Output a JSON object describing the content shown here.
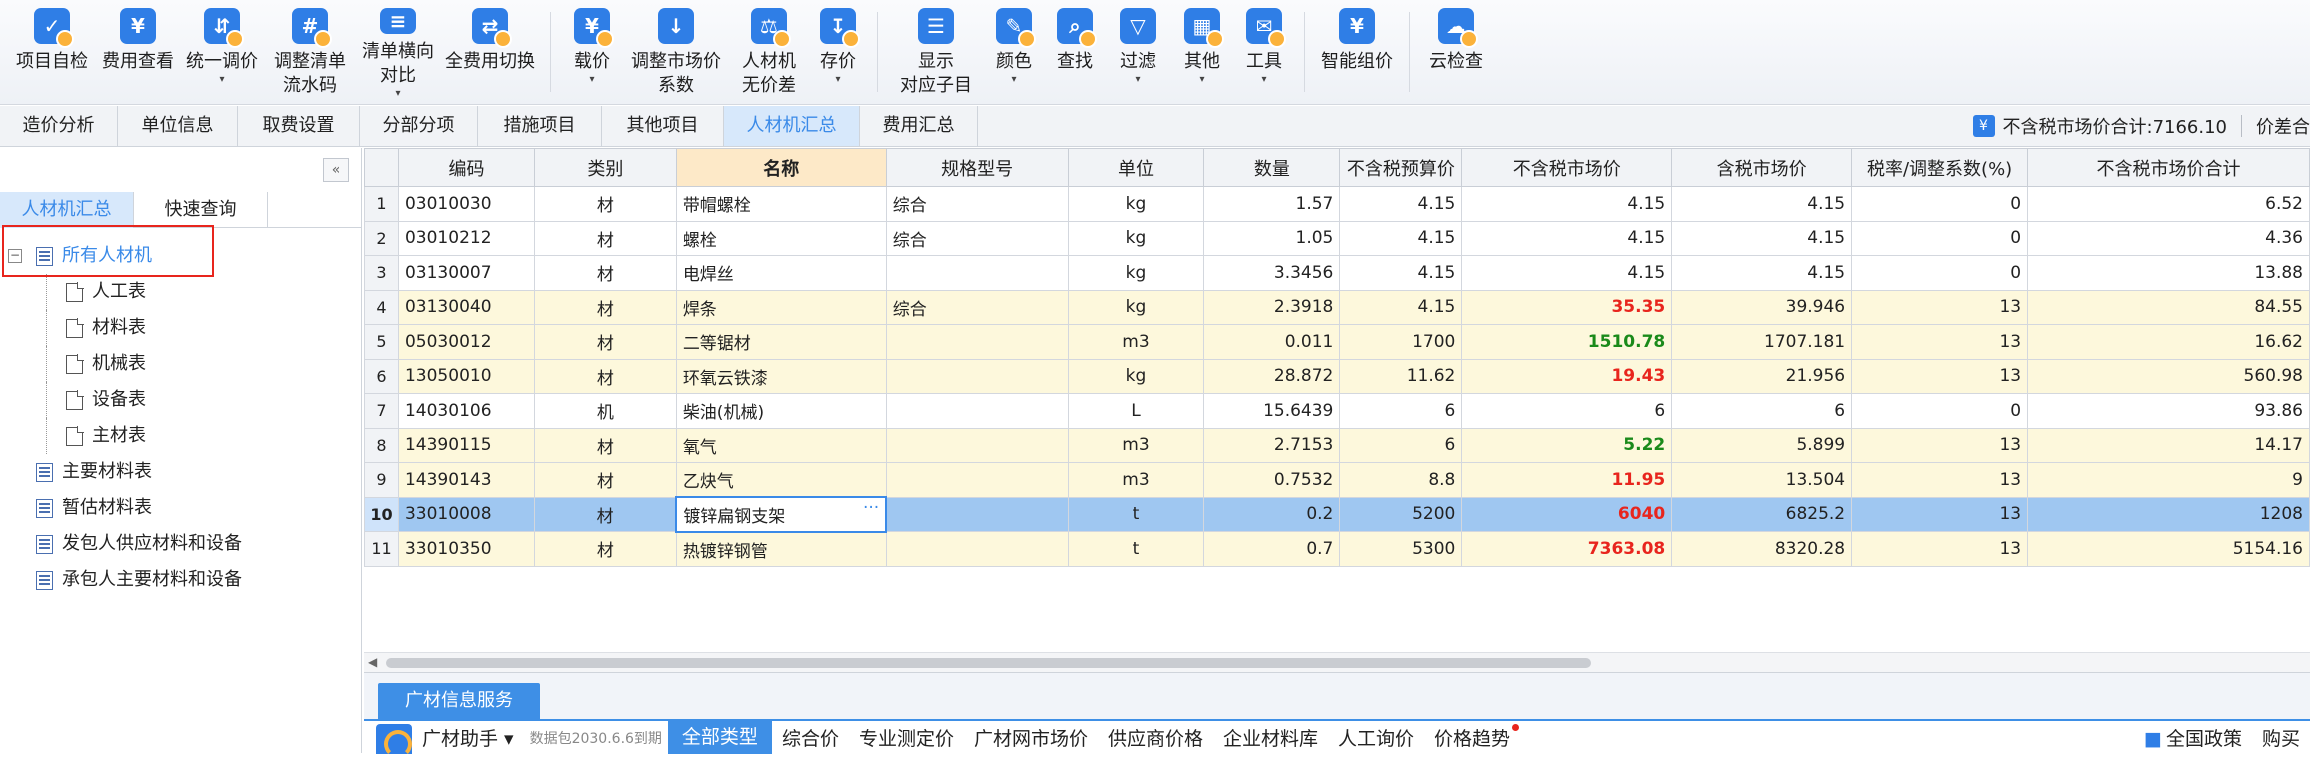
{
  "toolbar": [
    {
      "label": "项目自检",
      "icon": "check-icon",
      "dd": ""
    },
    {
      "label": "费用查看",
      "icon": "cost-view-icon",
      "dd": ""
    },
    {
      "label": "统一调价",
      "icon": "adjust-price-icon",
      "dd": "▾"
    },
    {
      "label": "调整清单\n流水码",
      "icon": "serial-code-icon",
      "dd": ""
    },
    {
      "label": "清单横向\n对比",
      "icon": "compare-icon",
      "dd": "▾"
    },
    {
      "label": "全费用切换",
      "icon": "switch-icon",
      "dd": ""
    },
    {
      "label": "载价",
      "icon": "load-price-icon",
      "dd": "▾"
    },
    {
      "label": "调整市场价\n系数",
      "icon": "coefficient-icon",
      "dd": ""
    },
    {
      "label": "人材机\n无价差",
      "icon": "balance-icon",
      "dd": ""
    },
    {
      "label": "存价",
      "icon": "save-price-icon",
      "dd": "▾"
    },
    {
      "label": "显示\n对应子目",
      "icon": "show-item-icon",
      "dd": ""
    },
    {
      "label": "颜色",
      "icon": "paint-icon",
      "dd": "▾"
    },
    {
      "label": "查找",
      "icon": "binoculars-icon",
      "dd": ""
    },
    {
      "label": "过滤",
      "icon": "filter-icon",
      "dd": "▾"
    },
    {
      "label": "其他",
      "icon": "grid-icon",
      "dd": "▾"
    },
    {
      "label": "工具",
      "icon": "tool-icon",
      "dd": "▾"
    },
    {
      "label": "智能组价",
      "icon": "smart-price-icon",
      "dd": ""
    },
    {
      "label": "云检查",
      "icon": "cloud-check-icon",
      "dd": ""
    }
  ],
  "tabs": [
    {
      "label": "造价分析"
    },
    {
      "label": "单位信息"
    },
    {
      "label": "取费设置"
    },
    {
      "label": "分部分项"
    },
    {
      "label": "措施项目"
    },
    {
      "label": "其他项目"
    },
    {
      "label": "人材机汇总"
    },
    {
      "label": "费用汇总"
    }
  ],
  "summary": {
    "total_label": "不含税市场价合计:7166.10",
    "diff_label": "价差合"
  },
  "left": {
    "collapse": "«",
    "subtabs": [
      {
        "label": "人材机汇总"
      },
      {
        "label": "快速查询"
      }
    ],
    "tree": [
      {
        "label": "所有人材机",
        "type": "fold"
      },
      {
        "label": "人工表",
        "type": "doc"
      },
      {
        "label": "材料表",
        "type": "doc"
      },
      {
        "label": "机械表",
        "type": "doc"
      },
      {
        "label": "设备表",
        "type": "doc"
      },
      {
        "label": "主材表",
        "type": "doc"
      },
      {
        "label": "主要材料表",
        "type": "fold"
      },
      {
        "label": "暂估材料表",
        "type": "fold"
      },
      {
        "label": "发包人供应材料和设备",
        "type": "fold"
      },
      {
        "label": "承包人主要材料和设备",
        "type": "fold"
      }
    ]
  },
  "table": {
    "headers": [
      "编码",
      "类别",
      "名称",
      "规格型号",
      "单位",
      "数量",
      "不含税预算价",
      "不含税市场价",
      "含税市场价",
      "税率/调整系数(%)",
      "不含税市场价合计"
    ],
    "rows": [
      {
        "n": "1",
        "code": "03010030",
        "cat": "材",
        "name": "带帽螺栓",
        "spec": "综合",
        "unit": "kg",
        "qty": "1.57",
        "budget": "4.15",
        "market": "4.15",
        "tax_market": "4.15",
        "rate": "0",
        "total": "6.52",
        "style": "",
        "mk": ""
      },
      {
        "n": "2",
        "code": "03010212",
        "cat": "材",
        "name": "螺栓",
        "spec": "综合",
        "unit": "kg",
        "qty": "1.05",
        "budget": "4.15",
        "market": "4.15",
        "tax_market": "4.15",
        "rate": "0",
        "total": "4.36",
        "style": "",
        "mk": ""
      },
      {
        "n": "3",
        "code": "03130007",
        "cat": "材",
        "name": "电焊丝",
        "spec": "",
        "unit": "kg",
        "qty": "3.3456",
        "budget": "4.15",
        "market": "4.15",
        "tax_market": "4.15",
        "rate": "0",
        "total": "13.88",
        "style": "",
        "mk": ""
      },
      {
        "n": "4",
        "code": "03130040",
        "cat": "材",
        "name": "焊条",
        "spec": "综合",
        "unit": "kg",
        "qty": "2.3918",
        "budget": "4.15",
        "market": "35.35",
        "tax_market": "39.946",
        "rate": "13",
        "total": "84.55",
        "style": "y",
        "mk": "red"
      },
      {
        "n": "5",
        "code": "05030012",
        "cat": "材",
        "name": "二等锯材",
        "spec": "",
        "unit": "m3",
        "qty": "0.011",
        "budget": "1700",
        "market": "1510.78",
        "tax_market": "1707.181",
        "rate": "13",
        "total": "16.62",
        "style": "y",
        "mk": "grn"
      },
      {
        "n": "6",
        "code": "13050010",
        "cat": "材",
        "name": "环氧云铁漆",
        "spec": "",
        "unit": "kg",
        "qty": "28.872",
        "budget": "11.62",
        "market": "19.43",
        "tax_market": "21.956",
        "rate": "13",
        "total": "560.98",
        "style": "y",
        "mk": "red"
      },
      {
        "n": "7",
        "code": "14030106",
        "cat": "机",
        "name": "柴油(机械)",
        "spec": "",
        "unit": "L",
        "qty": "15.6439",
        "budget": "6",
        "market": "6",
        "tax_market": "6",
        "rate": "0",
        "total": "93.86",
        "style": "",
        "mk": ""
      },
      {
        "n": "8",
        "code": "14390115",
        "cat": "材",
        "name": "氧气",
        "spec": "",
        "unit": "m3",
        "qty": "2.7153",
        "budget": "6",
        "market": "5.22",
        "tax_market": "5.899",
        "rate": "13",
        "total": "14.17",
        "style": "y",
        "mk": "grn"
      },
      {
        "n": "9",
        "code": "14390143",
        "cat": "材",
        "name": "乙炔气",
        "spec": "",
        "unit": "m3",
        "qty": "0.7532",
        "budget": "8.8",
        "market": "11.95",
        "tax_market": "13.504",
        "rate": "13",
        "total": "9",
        "style": "y",
        "mk": "red"
      },
      {
        "n": "10",
        "code": "33010008",
        "cat": "材",
        "name": "镀锌扁钢支架",
        "spec": "",
        "unit": "t",
        "qty": "0.2",
        "budget": "5200",
        "market": "6040",
        "tax_market": "6825.2",
        "rate": "13",
        "total": "1208",
        "style": "sel",
        "mk": "red"
      },
      {
        "n": "11",
        "code": "33010350",
        "cat": "材",
        "name": "热镀锌钢管",
        "spec": "",
        "unit": "t",
        "qty": "0.7",
        "budget": "5300",
        "market": "7363.08",
        "tax_market": "8320.28",
        "rate": "13",
        "total": "5154.16",
        "style": "y",
        "mk": "red"
      }
    ],
    "ellipsis": "···"
  },
  "bottom": {
    "tab": "广材信息服务",
    "assistant": "广材助手 ▾",
    "data_note": "数据包2030.6.6到期",
    "items": [
      {
        "label": "全部类型",
        "active": true,
        "dot": false
      },
      {
        "label": "综合价",
        "active": false,
        "dot": false
      },
      {
        "label": "专业测定价",
        "active": false,
        "dot": false
      },
      {
        "label": "广材网市场价",
        "active": false,
        "dot": false
      },
      {
        "label": "供应商价格",
        "active": false,
        "dot": false
      },
      {
        "label": "企业材料库",
        "active": false,
        "dot": false
      },
      {
        "label": "人工询价",
        "active": false,
        "dot": false
      },
      {
        "label": "价格趋势",
        "active": false,
        "dot": true
      }
    ],
    "right1": "全国政策",
    "right2": "购买"
  }
}
